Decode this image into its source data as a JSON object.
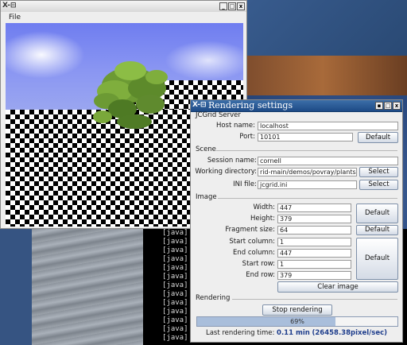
{
  "desktop": {
    "terminal_lines": [
      "[java]",
      "[java]",
      "[java]",
      "[java]",
      "[java]",
      "[java]",
      "[java]",
      "[java]",
      "[java]",
      "[java]",
      "[java]",
      "[java]",
      "[java]"
    ]
  },
  "pov_window": {
    "title_icon": "X-⊟",
    "menu": {
      "file": "File"
    },
    "buttons": [
      "_",
      "□",
      "x"
    ]
  },
  "settings_window": {
    "title_icon": "X-⊟",
    "title": "Rendering settings",
    "buttons": [
      "▪",
      "□",
      "x"
    ],
    "server": {
      "section": "JCGrid Server",
      "host_label": "Host name:",
      "host_value": "localhost",
      "port_label": "Port:",
      "port_value": "10101",
      "default_label": "Default"
    },
    "scene": {
      "section": "Scene",
      "session_label": "Session name:",
      "session_value": "cornell",
      "workdir_label": "Working directory:",
      "workdir_value": "rid-main/demos/povray/plants",
      "ini_label": "INI file:",
      "ini_value": "jcgrid.ini",
      "select_label": "Select"
    },
    "image": {
      "section": "Image",
      "width_label": "Width:",
      "width_value": "447",
      "height_label": "Height:",
      "height_value": "379",
      "fragment_label": "Fragment size:",
      "fragment_value": "64",
      "start_col_label": "Start column:",
      "start_col_value": "1",
      "end_col_label": "End column:",
      "end_col_value": "447",
      "start_row_label": "Start row:",
      "start_row_value": "1",
      "end_row_label": "End row:",
      "end_row_value": "379",
      "default_label": "Default",
      "clear_label": "Clear image"
    },
    "rendering": {
      "section": "Rendering",
      "stop_label": "Stop rendering",
      "progress_text": "69%",
      "progress_fraction": 0.69,
      "last_time_prefix": "Last rendering time:",
      "last_time_value": "0.11 min",
      "last_time_rate": "(26458.38pixel/sec)"
    }
  }
}
